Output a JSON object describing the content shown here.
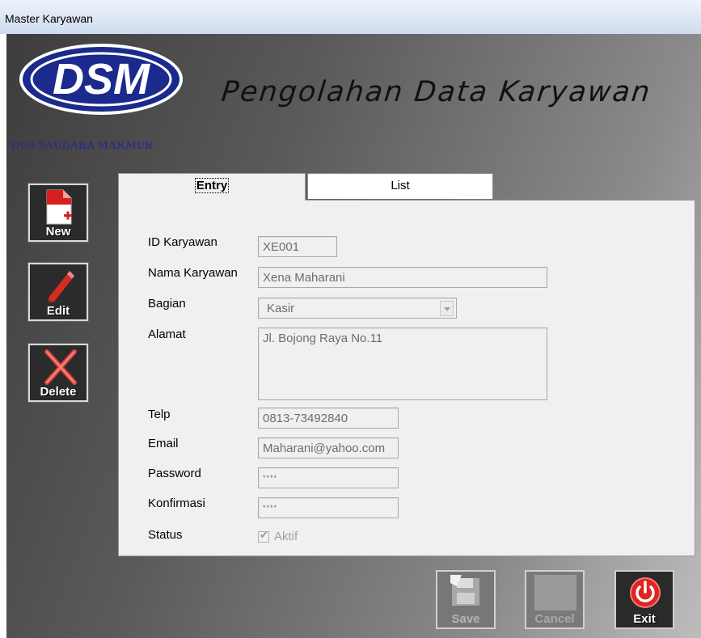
{
  "window": {
    "title": "Master Karyawan"
  },
  "header": {
    "logo_text": "DSM",
    "company_name": "DUA SAUDARA MAKMUR",
    "app_title": "Pengolahan Data Karyawan"
  },
  "toolbar": {
    "new_label": "New",
    "edit_label": "Edit",
    "delete_label": "Delete"
  },
  "tabs": [
    {
      "label": "Entry",
      "active": true
    },
    {
      "label": "List",
      "active": false
    }
  ],
  "form": {
    "id_label": "ID Karyawan",
    "id_value": "XE001",
    "nama_label": "Nama Karyawan",
    "nama_value": "Xena Maharani",
    "bagian_label": "Bagian",
    "bagian_value": "Kasir",
    "alamat_label": "Alamat",
    "alamat_value": "Jl. Bojong Raya No.11",
    "telp_label": "Telp",
    "telp_value": "0813-73492840",
    "email_label": "Email",
    "email_value": "Maharani@yahoo.com",
    "password_label": "Password",
    "password_value": "****",
    "konfirmasi_label": "Konfirmasi",
    "konfirmasi_value": "****",
    "status_label": "Status",
    "status_checkbox_label": "Aktif",
    "status_checked": true
  },
  "actions": {
    "save_label": "Save",
    "cancel_label": "Cancel",
    "exit_label": "Exit"
  },
  "colors": {
    "company_name": "#2d2f86",
    "logo_blue": "#1b2a8c",
    "exit_red": "#e0241f"
  }
}
